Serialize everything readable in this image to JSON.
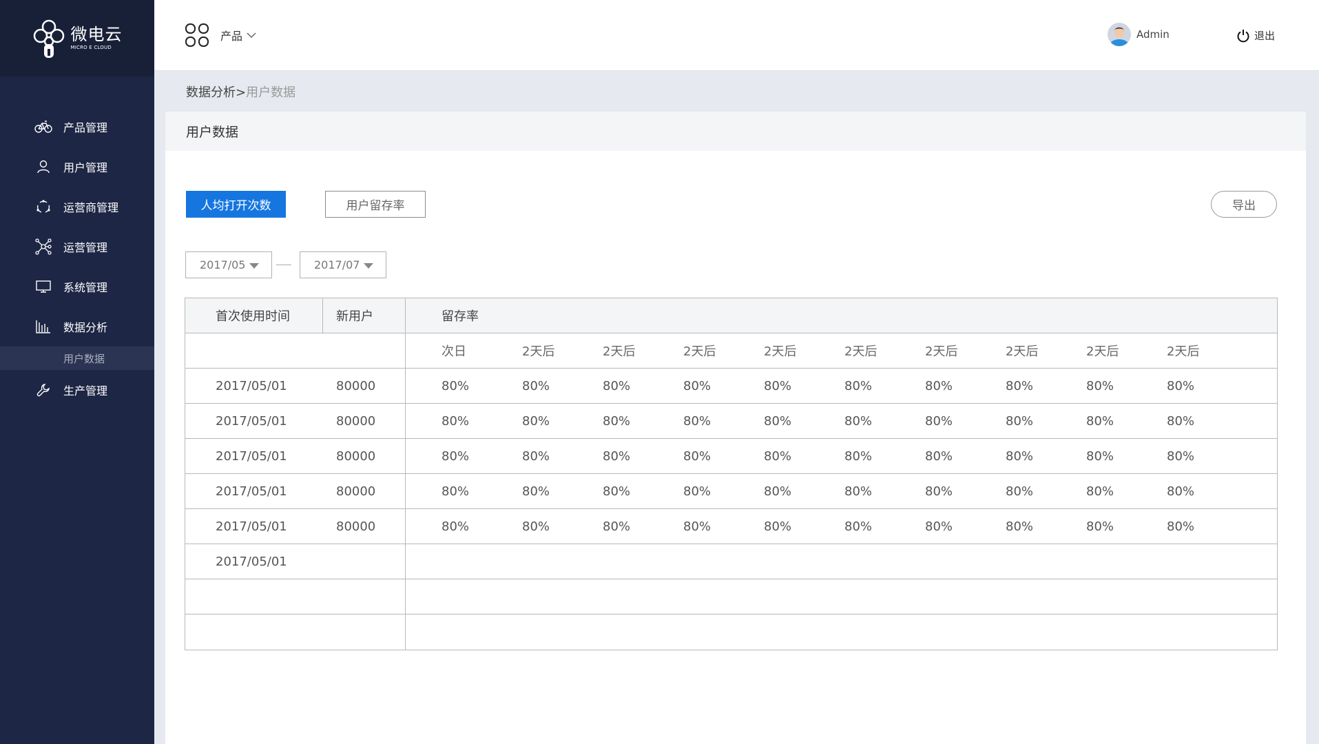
{
  "logo": {
    "name_cn": "微电云",
    "name_en": "MICRO E CLOUD"
  },
  "sidebar": {
    "items": [
      {
        "label": "产品管理",
        "icon": "bicycle-icon"
      },
      {
        "label": "用户管理",
        "icon": "user-icon"
      },
      {
        "label": "运营商管理",
        "icon": "cycle-icon"
      },
      {
        "label": "运营管理",
        "icon": "network-icon"
      },
      {
        "label": "系统管理",
        "icon": "monitor-icon"
      },
      {
        "label": "数据分析",
        "icon": "bar-chart-icon"
      },
      {
        "label": "用户数据",
        "icon": ""
      },
      {
        "label": "生产管理",
        "icon": "wrench-icon"
      }
    ]
  },
  "header": {
    "product_label": "产品",
    "user_name": "Admin",
    "logout_label": "退出"
  },
  "breadcrumb": {
    "parent": "数据分析>",
    "current": "用户数据"
  },
  "main": {
    "title": "用户数据",
    "tabs": [
      "人均打开次数",
      "用户留存率"
    ],
    "export_label": "导出",
    "date_from": "2017/05",
    "date_to": "2017/07"
  },
  "table": {
    "headers": [
      "首次使用时间",
      "新用户",
      "留存率"
    ],
    "sub_headers": [
      "次日",
      "2天后",
      "2天后",
      "2天后",
      "2天后",
      "2天后",
      "2天后",
      "2天后",
      "2天后",
      "2天后"
    ],
    "rows": [
      {
        "date": "2017/05/01",
        "new_users": "80000",
        "rates": [
          "80%",
          "80%",
          "80%",
          "80%",
          "80%",
          "80%",
          "80%",
          "80%",
          "80%",
          "80%"
        ]
      },
      {
        "date": "2017/05/01",
        "new_users": "80000",
        "rates": [
          "80%",
          "80%",
          "80%",
          "80%",
          "80%",
          "80%",
          "80%",
          "80%",
          "80%",
          "80%"
        ]
      },
      {
        "date": "2017/05/01",
        "new_users": "80000",
        "rates": [
          "80%",
          "80%",
          "80%",
          "80%",
          "80%",
          "80%",
          "80%",
          "80%",
          "80%",
          "80%"
        ]
      },
      {
        "date": "2017/05/01",
        "new_users": "80000",
        "rates": [
          "80%",
          "80%",
          "80%",
          "80%",
          "80%",
          "80%",
          "80%",
          "80%",
          "80%",
          "80%"
        ]
      },
      {
        "date": "2017/05/01",
        "new_users": "80000",
        "rates": [
          "80%",
          "80%",
          "80%",
          "80%",
          "80%",
          "80%",
          "80%",
          "80%",
          "80%",
          "80%"
        ]
      },
      {
        "date": "2017/05/01",
        "new_users": "",
        "rates": []
      },
      {
        "date": "",
        "new_users": "",
        "rates": []
      },
      {
        "date": "",
        "new_users": "",
        "rates": []
      }
    ]
  },
  "colors": {
    "sidebar_bg": "#1d2644",
    "accent": "#1676e0"
  }
}
